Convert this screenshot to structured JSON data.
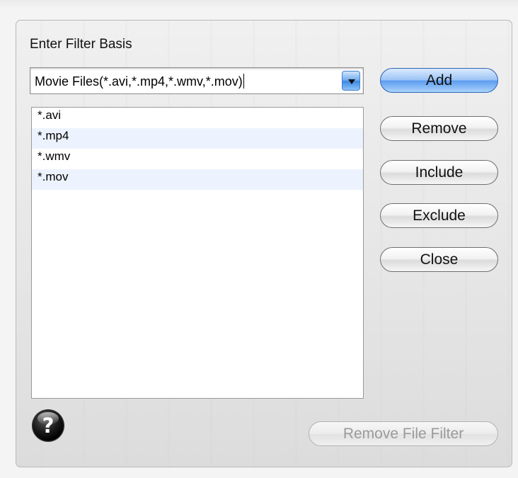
{
  "dialog": {
    "heading": "Enter Filter Basis",
    "filter_value": "Movie Files(*.avi,*.mp4,*.wmv,*.mov)",
    "list_items": [
      "*.avi",
      "*.mp4",
      "*.wmv",
      "*.mov"
    ],
    "buttons": {
      "add": "Add",
      "remove": "Remove",
      "include": "Include",
      "exclude": "Exclude",
      "close": "Close",
      "remove_file_filter": "Remove File Filter"
    },
    "help_glyph": "?",
    "icons": {
      "dropdown": "chevron-down-icon",
      "help": "help-icon"
    },
    "colors": {
      "accent": "#5d9cef",
      "alt_row": "#edf3fe",
      "disabled_text": "#9a9a9a"
    }
  }
}
